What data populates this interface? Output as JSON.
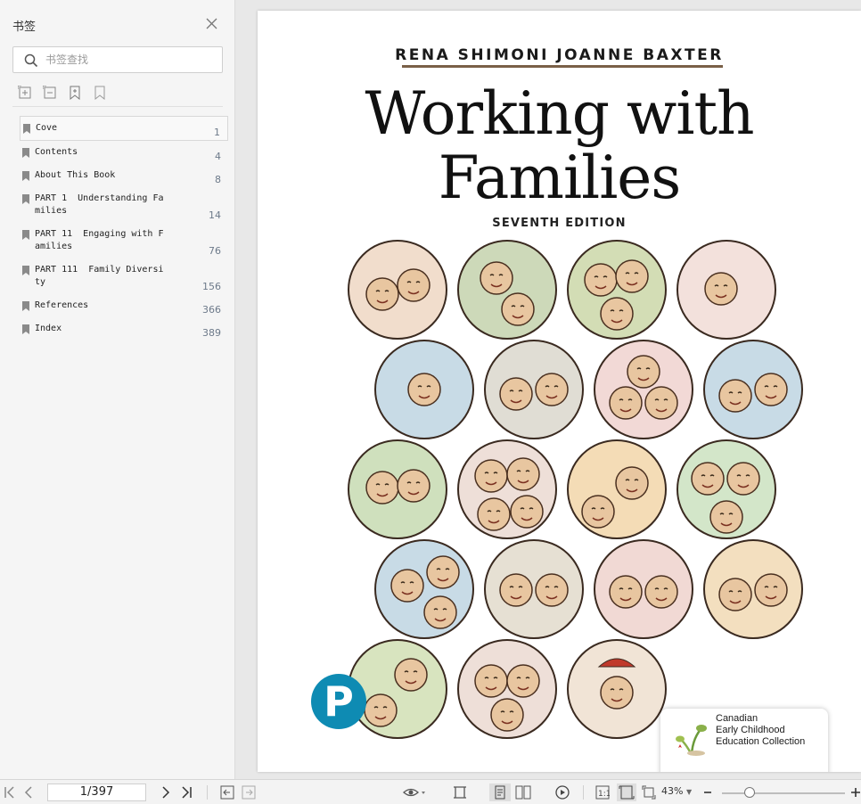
{
  "sidebar": {
    "title": "书签",
    "search_placeholder": "书签查找",
    "bookmarks": [
      {
        "label": "Cove",
        "page": "1"
      },
      {
        "label": "Contents",
        "page": "4"
      },
      {
        "label": "About This Book",
        "page": "8"
      },
      {
        "label": "PART 1  Understanding Fa\nmilies",
        "page": "14"
      },
      {
        "label": "PART 11  Engaging with F\namilies",
        "page": "76"
      },
      {
        "label": "PART 111  Family Diversi\nty",
        "page": "156"
      },
      {
        "label": "References",
        "page": "366"
      },
      {
        "label": "Index",
        "page": "389"
      }
    ]
  },
  "cover": {
    "authors": "RENA SHIMONI   JOANNE BAXTER",
    "title_line1": "Working with",
    "title_line2": "Families",
    "edition": "SEVENTH EDITION",
    "publisher_logo": "P",
    "collection_text": "Canadian\nEarly Childhood\nEducation Collection",
    "accent_color": "#7a6048",
    "publisher_color": "#0e8bb3"
  },
  "toolbar": {
    "page_indicator": "1/397",
    "zoom_level": "43%"
  },
  "colors": {
    "sidebar_bg": "#f5f5f5",
    "toolbar_bg": "#f3f3f3",
    "page_number": "#6d7a8a"
  }
}
